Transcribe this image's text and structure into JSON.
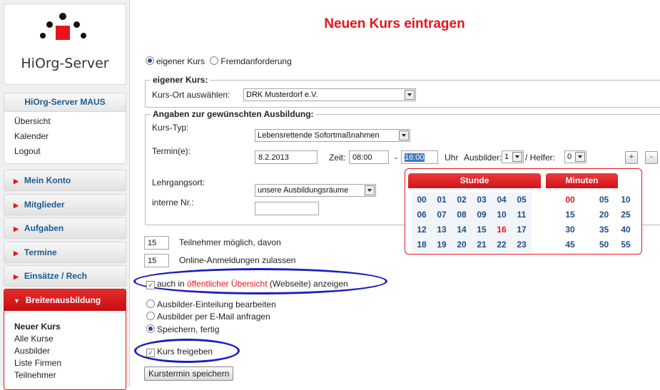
{
  "sidebar": {
    "logo_text": "HiOrg-Server",
    "maus": {
      "title": "HiOrg-Server MAUS",
      "links": [
        "Übersicht",
        "Kalender",
        "Logout"
      ]
    },
    "nav": [
      "Mein Konto",
      "Mitglieder",
      "Aufgaben",
      "Termine",
      "Einsätze / Rech"
    ],
    "open_section": {
      "title": "Breitenausbildung",
      "items": [
        "Neuer Kurs",
        "Alle Kurse",
        "Ausbilder",
        "Liste Firmen",
        "Teilnehmer"
      ]
    }
  },
  "main": {
    "title": "Neuen Kurs eintragen",
    "radio_own": "eigener Kurs",
    "radio_foreign": "Fremdanforderung",
    "own_course": {
      "legend": "eigener Kurs:",
      "location_label": "Kurs-Ort auswählen:",
      "location_value": "DRK Musterdorf e.V."
    },
    "training": {
      "legend": "Angaben zur gewünschten Ausbildung:",
      "type_label": "Kurs-Typ:",
      "type_value": "Lebensrettende Sofortmaßnahmen",
      "date_label": "Termin(e):",
      "date_value": "8.2.2013",
      "time_label": "Zeit:",
      "time_from": "08:00",
      "time_dash": "-",
      "time_to": "16:00",
      "uhr": "Uhr",
      "trainer_label": "Ausbilder:",
      "trainer_value": "1",
      "helper_label": "/ Helfer:",
      "helper_value": "0",
      "plus": "+",
      "minus": "-",
      "venue_label": "Lehrgangsort:",
      "venue_value": "unsere Ausbildungsräume",
      "internal_label": "interne Nr.:",
      "internal_value": ""
    },
    "participants_value": "15",
    "participants_label": "Teilnehmer möglich, davon",
    "online_value": "15",
    "online_label": "Online-Anmeldungen zulassen",
    "public_prefix": "auch in",
    "public_link": "öffentlicher Übersicht",
    "public_suffix": "(Webseite) anzeigen",
    "options": [
      "Ausbilder-Einteilung bearbeiten",
      "Ausbilder per E-Mail anfragen",
      "Speichern, fertig"
    ],
    "release_label": "Kurs freigeben",
    "submit_label": "Kurstermin speichern"
  },
  "time_picker": {
    "hours_title": "Stunde",
    "minutes_title": "Minuten",
    "hours": [
      "00",
      "01",
      "02",
      "03",
      "04",
      "05",
      "06",
      "07",
      "08",
      "09",
      "10",
      "11",
      "12",
      "13",
      "14",
      "15",
      "16",
      "17",
      "18",
      "19",
      "20",
      "21",
      "22",
      "23"
    ],
    "minutes": [
      "00",
      "05",
      "10",
      "15",
      "20",
      "25",
      "30",
      "35",
      "40",
      "45",
      "50",
      "55"
    ],
    "selected_hour": "16",
    "selected_minute": "00"
  },
  "colors": {
    "accent": "#e8141b",
    "link_blue": "#1a5a8e",
    "highlight_ellipse": "#1b1fbf"
  }
}
